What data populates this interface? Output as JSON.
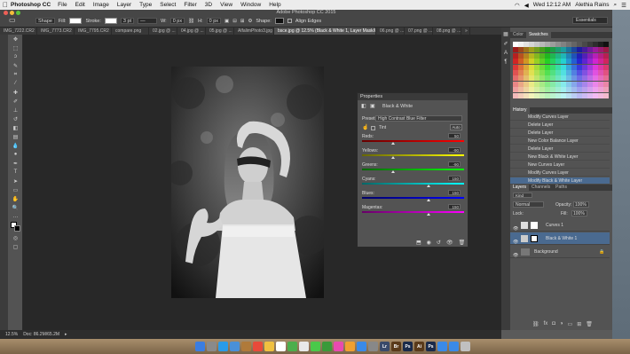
{
  "menubar": {
    "app": "Photoshop CC",
    "items": [
      "File",
      "Edit",
      "Image",
      "Layer",
      "Type",
      "Select",
      "Filter",
      "3D",
      "View",
      "Window",
      "Help"
    ],
    "clock": "Wed 12:12 AM",
    "user": "Alethia Rains"
  },
  "window_title": "Adobe Photoshop CC 2015",
  "options": {
    "shape_mode": "Shape",
    "fill_label": "Fill:",
    "stroke_label": "Stroke:",
    "stroke_size": "3 pt",
    "w_value": "0 px",
    "h_value": "0 px",
    "shape_label": "Shape:",
    "align_edges": "Align Edges",
    "workspace": "Essentials"
  },
  "tabs": [
    "IMG_7222.CR2",
    "IMG_7773.CR2",
    "IMG_7795.CR2",
    "compare.png",
    "02.jpg @ ...",
    "04.jpg @ ...",
    "05.jpg @ ...",
    "AlfalimPhoto3.jpg",
    "bsce.jpg @ 12.5% (Black & White 1, Layer Mask/8)",
    "06.png @ ...",
    "07.png @ ...",
    "08.png @ ..."
  ],
  "properties": {
    "title": "Properties",
    "subtitle": "Black & White",
    "preset_label": "Preset:",
    "preset_value": "High Contrast Blue Filter",
    "tint_label": "Tint",
    "auto_label": "Auto",
    "sliders": [
      {
        "label": "Reds:",
        "value": "50"
      },
      {
        "label": "Yellows:",
        "value": "-90"
      },
      {
        "label": "Greens:",
        "value": "-90"
      },
      {
        "label": "Cyans:",
        "value": "150"
      },
      {
        "label": "Blues:",
        "value": "150"
      },
      {
        "label": "Magentas:",
        "value": "150"
      }
    ]
  },
  "status": {
    "zoom": "12.5%",
    "doc": "Doc: 86.2M/65.2M"
  },
  "panels": {
    "color_tabs": [
      "Color",
      "Swatches"
    ],
    "history_tab": "History",
    "history_items": [
      "Modify Curves Layer",
      "Delete Layer",
      "Delete Layer",
      "New Color Balance Layer",
      "Delete Layer",
      "New Black & White Layer",
      "New Curves Layer",
      "Modify Curves Layer",
      "Modify Black & White Layer"
    ],
    "layers_tabs": [
      "Layers",
      "Channels",
      "Paths"
    ],
    "kind_label": "Kind",
    "blend_mode": "Normal",
    "opacity_label": "Opacity:",
    "opacity_value": "100%",
    "lock_label": "Lock:",
    "fill_label": "Fill:",
    "fill_value": "100%",
    "layers": [
      "Curves 1",
      "Black & White 1",
      "Background"
    ]
  },
  "dock": [
    "Finder",
    "Launchpad",
    "Safari",
    "Mail",
    "Contacts",
    "Calendar",
    "Notes",
    "Reminders",
    "Maps",
    "Photos",
    "Messages",
    "FaceTime",
    "iTunes",
    "iBooks",
    "App Store",
    "Preferences",
    "Lr",
    "Br",
    "Ps",
    "Ai",
    "Ps",
    "Folder",
    "Folder",
    "Trash"
  ]
}
